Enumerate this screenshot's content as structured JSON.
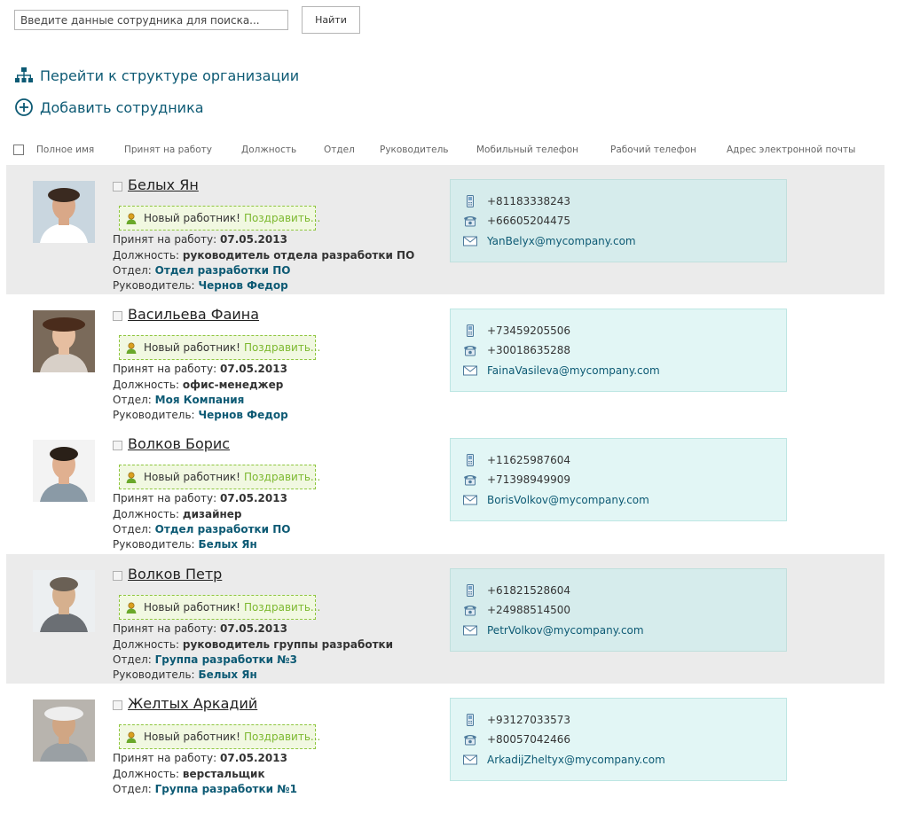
{
  "search": {
    "placeholder": "Введите данные сотрудника для поиска...",
    "button_label": "Найти"
  },
  "actions": {
    "org_structure": "Перейти к структуре организации",
    "add_employee": "Добавить сотрудника"
  },
  "columns": [
    "Полное имя",
    "Принят на работу",
    "Должность",
    "Отдел",
    "Руководитель",
    "Мобильный телефон",
    "Рабочий телефон",
    "Адрес электронной почты"
  ],
  "labels": {
    "new_worker": "Новый работник!",
    "congratulate": "Поздравить...",
    "hired": "Принят на работу:",
    "position": "Должность:",
    "department": "Отдел:",
    "manager": "Руководитель:"
  },
  "employees": [
    {
      "name": "Белых Ян",
      "hired": "07.05.2013",
      "position": "руководитель отдела разработки ПО",
      "department": "Отдел разработки ПО",
      "manager": "Чернов Федор",
      "mobile": "+81183338243",
      "work_phone": "+66605204475",
      "email": "YanBelyx@mycompany.com",
      "shaded": true
    },
    {
      "name": "Васильева Фаина",
      "hired": "07.05.2013",
      "position": "офис-менеджер",
      "department": "Моя Компания",
      "manager": "Чернов Федор",
      "mobile": "+73459205506",
      "work_phone": "+30018635288",
      "email": "FainaVasileva@mycompany.com",
      "shaded": false
    },
    {
      "name": "Волков Борис",
      "hired": "07.05.2013",
      "position": "дизайнер",
      "department": "Отдел разработки ПО",
      "manager": "Белых Ян",
      "mobile": "+11625987604",
      "work_phone": "+71398949909",
      "email": "BorisVolkov@mycompany.com",
      "shaded": false
    },
    {
      "name": "Волков Петр",
      "hired": "07.05.2013",
      "position": "руководитель группы разработки",
      "department": "Группа разработки №3",
      "manager": "Белых Ян",
      "mobile": "+61821528604",
      "work_phone": "+24988514500",
      "email": "PetrVolkov@mycompany.com",
      "shaded": true
    },
    {
      "name": "Желтых Аркадий",
      "hired": "07.05.2013",
      "position": "верстальщик",
      "department": "Группа разработки №1",
      "manager": "",
      "mobile": "+93127033573",
      "work_phone": "+80057042466",
      "email": "ArkadijZheltyx@mycompany.com",
      "shaded": false
    }
  ],
  "colors": {
    "accent": "#0d5a74",
    "congrats_green": "#7cb82f",
    "row_shade": "#ebebeb",
    "contact_bg": "#e2f6f5"
  },
  "icons": {
    "org": "org-structure-icon",
    "add": "add-circle-icon",
    "user": "user-icon",
    "mobile": "mobile-phone-icon",
    "phone": "desk-phone-icon",
    "mail": "mail-icon"
  }
}
